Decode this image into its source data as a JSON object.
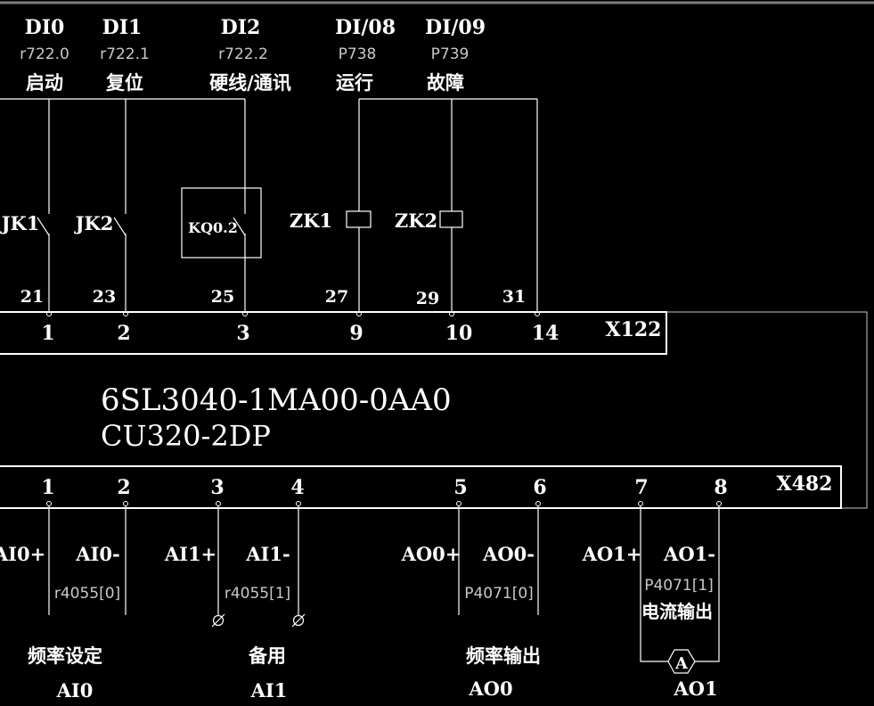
{
  "inputs_top": [
    {
      "id": "DI0",
      "param": "r722.0",
      "func": "启动"
    },
    {
      "id": "DI1",
      "param": "r722.1",
      "func": "复位"
    },
    {
      "id": "DI2",
      "param": "r722.2",
      "func": "硬线/通讯"
    },
    {
      "id": "DI/08",
      "param": "P738",
      "func": "运行"
    },
    {
      "id": "DI/09",
      "param": "P739",
      "func": "故障"
    }
  ],
  "contacts": {
    "jk1": "JK1",
    "jk2": "JK2",
    "kq": "KQ0.2",
    "zk1": "ZK1",
    "zk2": "ZK2"
  },
  "wire_numbers": [
    "21",
    "23",
    "25",
    "27",
    "29",
    "31"
  ],
  "x122": {
    "name": "X122",
    "pins": [
      "1",
      "2",
      "3",
      "9",
      "10",
      "14"
    ]
  },
  "module": {
    "part_number": "6SL3040-1MA00-0AA0",
    "model": "CU320-2DP"
  },
  "x482": {
    "name": "X482",
    "pins": [
      "1",
      "2",
      "3",
      "4",
      "5",
      "6",
      "7",
      "8"
    ]
  },
  "analog": {
    "signals": [
      "AI0+",
      "AI0-",
      "AI1+",
      "AI1-",
      "AO0+",
      "AO0-",
      "AO1+",
      "AO1-"
    ],
    "params": [
      "r4055[0]",
      "r4055[1]",
      "P4071[0]",
      "P4071[1]"
    ],
    "current_output": "电流输出",
    "meter": "A"
  },
  "groups": [
    {
      "func": "频率设定",
      "name": "AI0"
    },
    {
      "func": "备用",
      "name": "AI1"
    },
    {
      "func": "频率输出",
      "name": "AO0"
    },
    {
      "func": "",
      "name": "AO1"
    }
  ]
}
